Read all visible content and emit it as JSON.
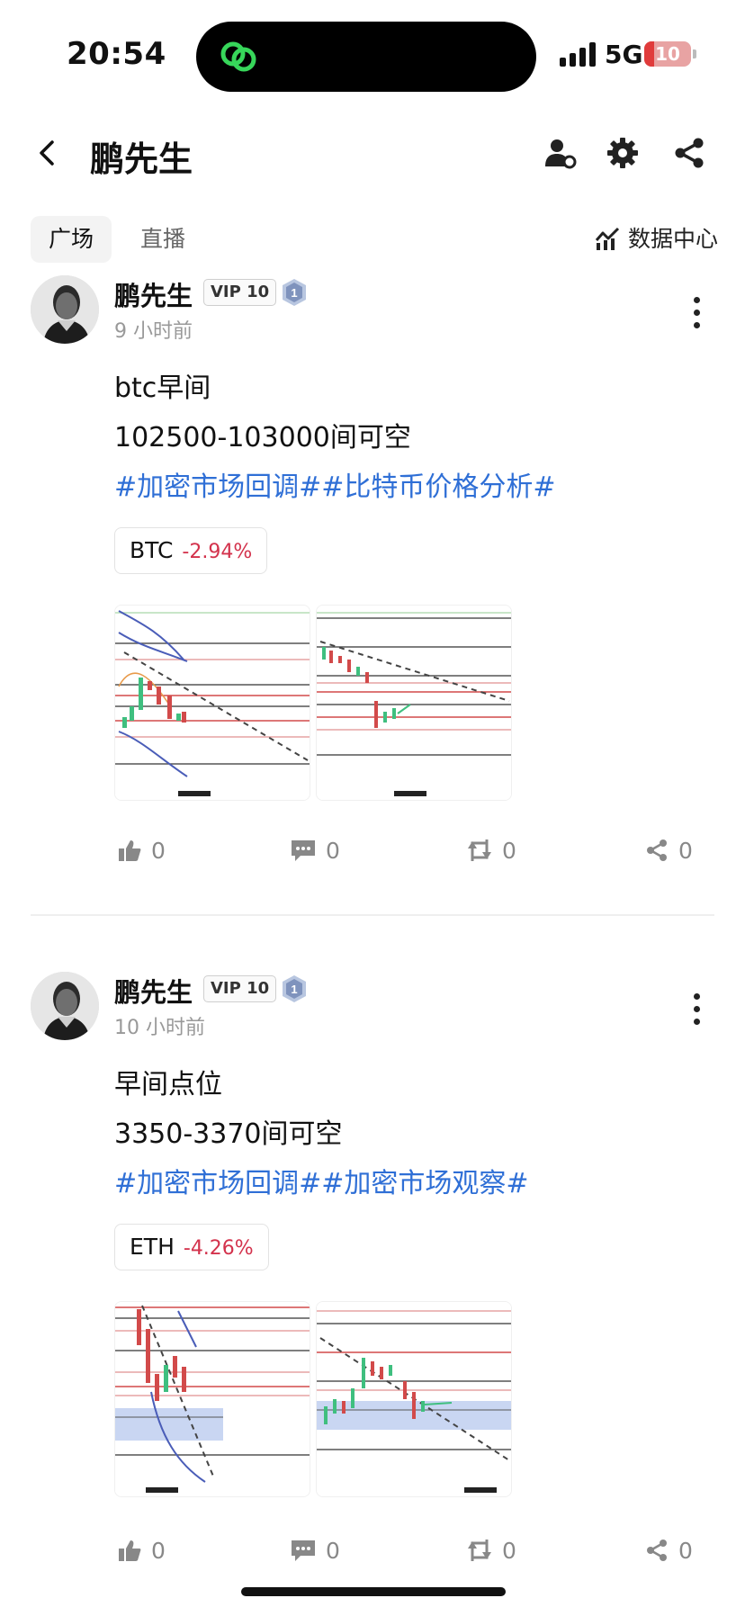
{
  "status_bar": {
    "time": "20:54",
    "network": "5G",
    "battery": "10",
    "battery_level": 0.1
  },
  "header": {
    "title": "鹏先生"
  },
  "tabs": [
    {
      "label": "广场",
      "active": true
    },
    {
      "label": "直播",
      "active": false
    }
  ],
  "data_center": {
    "label": "数据中心"
  },
  "posts": [
    {
      "author": "鹏先生",
      "vip": "VIP 10",
      "badge": "1",
      "time": "9 小时前",
      "lines": [
        "btc早间",
        "102500-103000间可空"
      ],
      "tags": "#加密市场回调##比特币价格分析#",
      "ticker": {
        "symbol": "BTC",
        "change": "-2.94%"
      },
      "actions": {
        "likes": "0",
        "comments": "0",
        "reposts": "0",
        "shares": "0"
      }
    },
    {
      "author": "鹏先生",
      "vip": "VIP 10",
      "badge": "1",
      "time": "10 小时前",
      "lines": [
        "早间点位",
        "3350-3370间可空"
      ],
      "tags": "#加密市场回调##加密市场观察#",
      "ticker": {
        "symbol": "ETH",
        "change": "-4.26%"
      },
      "actions": {
        "likes": "0",
        "comments": "0",
        "reposts": "0",
        "shares": "0"
      }
    }
  ],
  "colors": {
    "tag_blue": "#2f6fd6",
    "negative_red": "#d3324c",
    "battery_red": "#e03b3b"
  },
  "icons": [
    "back-icon",
    "user-settings-icon",
    "gear-icon",
    "share-icon",
    "chart-icon",
    "like-icon",
    "comment-icon",
    "repost-icon",
    "more-icon"
  ]
}
